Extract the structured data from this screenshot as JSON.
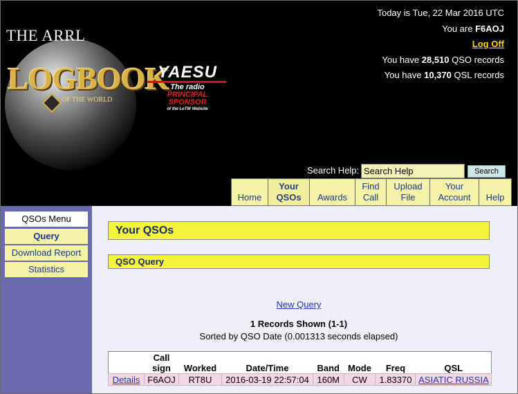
{
  "header": {
    "brand_arrl": "THE ARRL",
    "brand_logbook": "LOGBOOK",
    "brand_of_the_world": "OF THE WORLD",
    "sponsor": {
      "logo": "YAESU",
      "tagline": "The radio",
      "principal": "PRINCIPAL",
      "sponsor": "SPONSOR",
      "of_site": "of the LoTW Website"
    },
    "status": {
      "today": "Today is Tue, 22 Mar 2016 UTC",
      "you_are_prefix": "You are",
      "callsign": "F6AOJ",
      "logoff": "Log Off",
      "qso_prefix": "You have",
      "qso_count": "28,510",
      "qso_suffix": "QSO records",
      "qsl_prefix": "You have",
      "qsl_count": "10,370",
      "qsl_suffix": "QSL records"
    },
    "search": {
      "label": "Search Help:",
      "value": "Search Help",
      "button": "Search"
    },
    "nav": [
      {
        "label": "Home",
        "active": false
      },
      {
        "label": "Your QSOs",
        "active": true
      },
      {
        "label": "Awards",
        "active": false
      },
      {
        "label": "Find Call",
        "active": false
      },
      {
        "label": "Upload File",
        "active": false
      },
      {
        "label": "Your Account",
        "active": false
      },
      {
        "label": "Help",
        "active": false
      }
    ]
  },
  "sidebar": {
    "title": "QSOs Menu",
    "items": [
      {
        "label": "Query",
        "active": true
      },
      {
        "label": "Download Report",
        "active": false
      },
      {
        "label": "Statistics",
        "active": false
      }
    ]
  },
  "main": {
    "section_title": "Your QSOs",
    "subsection_title": "QSO Query",
    "new_query": "New Query",
    "records_shown": "1 Records Shown (1-1)",
    "sorted_by": "Sorted by QSO Date (0.001313 seconds elapsed)",
    "table": {
      "headers": [
        "",
        "Call sign",
        "Worked",
        "Date/Time",
        "Band",
        "Mode",
        "Freq",
        "QSL"
      ],
      "rows": [
        [
          "Details",
          "F6AOJ",
          "RT8U",
          "2016-03-19 22:57:04",
          "160M",
          "CW",
          "1.83370",
          "ASIATIC RUSSIA"
        ]
      ]
    }
  },
  "colors": {
    "header_bg": "#000000",
    "nav_bg": "#f5f3a8",
    "sidebar_bg": "#6a6ab0",
    "band_bg": "#f4f43a",
    "row_bg": "#f5d6e4",
    "link": "#1a3ab0",
    "logoff": "#ffd700"
  }
}
